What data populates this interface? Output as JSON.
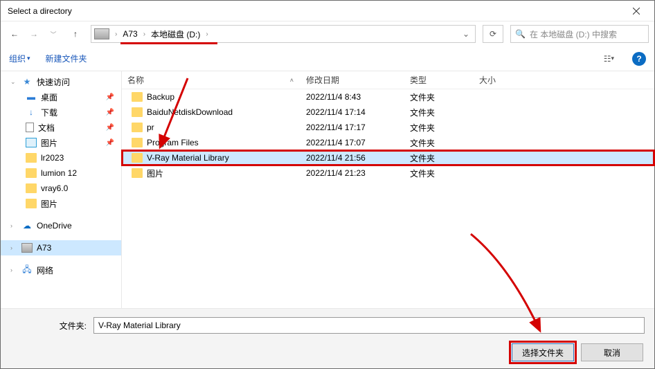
{
  "title": "Select a directory",
  "breadcrumb": {
    "seg1": "A73",
    "seg2": "本地磁盘 (D:)"
  },
  "search": {
    "placeholder": "在 本地磁盘 (D:) 中搜索"
  },
  "toolbar": {
    "organize": "组织",
    "new_folder": "新建文件夹"
  },
  "columns": {
    "name": "名称",
    "date": "修改日期",
    "type": "类型",
    "size": "大小"
  },
  "sidebar": {
    "quick": "快速访问",
    "desktop": "桌面",
    "downloads": "下载",
    "documents": "文档",
    "pictures": "图片",
    "lr2023": "lr2023",
    "lumion12": "lumion 12",
    "vray60": "vray6.0",
    "pictures2": "图片",
    "onedrive": "OneDrive",
    "a73": "A73",
    "network": "网络"
  },
  "rows": [
    {
      "name": "Backup",
      "date": "2022/11/4 8:43",
      "type": "文件夹"
    },
    {
      "name": "BaiduNetdiskDownload",
      "date": "2022/11/4 17:14",
      "type": "文件夹"
    },
    {
      "name": "pr",
      "date": "2022/11/4 17:17",
      "type": "文件夹"
    },
    {
      "name": "Program Files",
      "date": "2022/11/4 17:07",
      "type": "文件夹"
    },
    {
      "name": "V-Ray Material Library",
      "date": "2022/11/4 21:56",
      "type": "文件夹"
    },
    {
      "name": "图片",
      "date": "2022/11/4 21:23",
      "type": "文件夹"
    }
  ],
  "footer": {
    "label": "文件夹:",
    "value": "V-Ray Material Library",
    "select": "选择文件夹",
    "cancel": "取消"
  }
}
